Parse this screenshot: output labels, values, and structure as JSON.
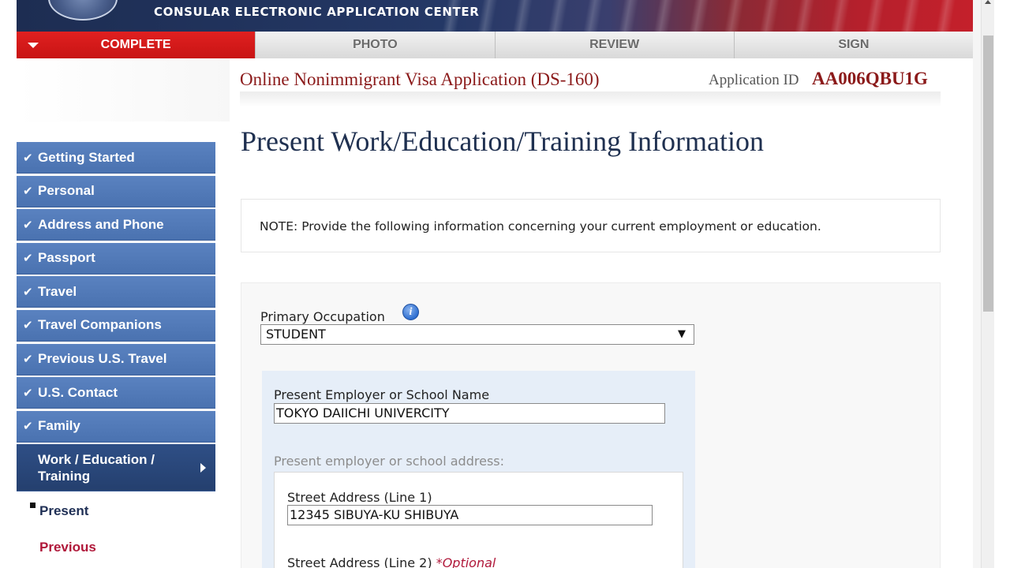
{
  "header": {
    "banner_title": "CONSULAR ELECTRONIC APPLICATION CENTER",
    "seal_icon": "us-department-of-state-seal-icon"
  },
  "tabs": [
    {
      "label": "COMPLETE",
      "active": true
    },
    {
      "label": "PHOTO",
      "active": false
    },
    {
      "label": "REVIEW",
      "active": false
    },
    {
      "label": "SIGN",
      "active": false
    }
  ],
  "application": {
    "title": "Online Nonimmigrant Visa Application (DS-160)",
    "id_label": "Application ID",
    "id_value": "AA006QBU1G"
  },
  "sidebar": {
    "items": [
      {
        "label": "Getting Started",
        "completed": true
      },
      {
        "label": "Personal",
        "completed": true
      },
      {
        "label": "Address and Phone",
        "completed": true
      },
      {
        "label": "Passport",
        "completed": true
      },
      {
        "label": "Travel",
        "completed": true
      },
      {
        "label": "Travel Companions",
        "completed": true
      },
      {
        "label": "Previous U.S. Travel",
        "completed": true
      },
      {
        "label": "U.S. Contact",
        "completed": true
      },
      {
        "label": "Family",
        "completed": true
      }
    ],
    "current": {
      "label": "Work / Education / Training"
    },
    "sub_items": [
      {
        "label": "Present",
        "selected": true
      },
      {
        "label": "Previous",
        "selected": false
      }
    ]
  },
  "main": {
    "heading": "Present Work/Education/Training Information",
    "note": "NOTE: Provide the following information concerning your current employment or education.",
    "primary_occupation": {
      "label": "Primary Occupation",
      "value": "STUDENT",
      "help_icon": "info-icon"
    },
    "employer": {
      "label": "Present Employer or School Name",
      "value": "TOKYO DAIICHI UNIVERCITY"
    },
    "address_section_label": "Present employer or school address:",
    "street1": {
      "label": "Street Address (Line 1)",
      "value": "12345 SIBUYA-KU SHIBUYA"
    },
    "street2": {
      "label": "Street Address (Line 2)",
      "optional": "*Optional"
    }
  },
  "colors": {
    "active_tab": "#d81a1a",
    "nav_blue": "#4f77b6",
    "nav_current": "#2a4778",
    "title_red": "#8b1a1a",
    "optional_red": "#b0183a"
  }
}
